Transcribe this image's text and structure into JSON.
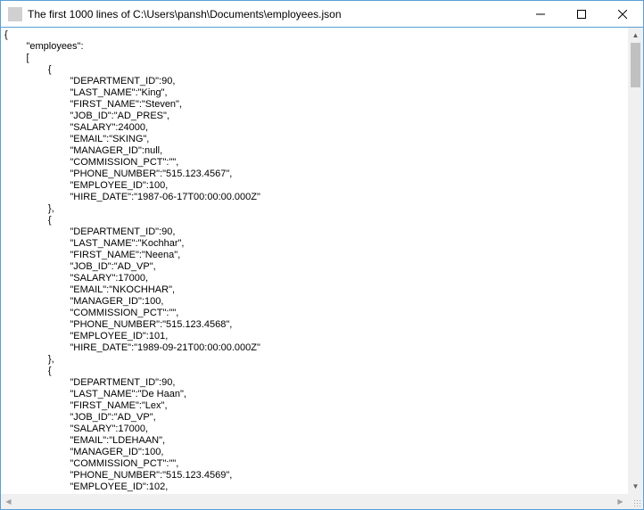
{
  "window": {
    "title": "The first 1000 lines of C:\\Users\\pansh\\Documents\\employees.json"
  },
  "file_text": "{\n\t\"employees\":\n\t[\n\t\t{\n\t\t\t\"DEPARTMENT_ID\":90,\n\t\t\t\"LAST_NAME\":\"King\",\n\t\t\t\"FIRST_NAME\":\"Steven\",\n\t\t\t\"JOB_ID\":\"AD_PRES\",\n\t\t\t\"SALARY\":24000,\n\t\t\t\"EMAIL\":\"SKING\",\n\t\t\t\"MANAGER_ID\":null,\n\t\t\t\"COMMISSION_PCT\":\"\",\n\t\t\t\"PHONE_NUMBER\":\"515.123.4567\",\n\t\t\t\"EMPLOYEE_ID\":100,\n\t\t\t\"HIRE_DATE\":\"1987-06-17T00:00:00.000Z\"\n\t\t},\n\t\t{\n\t\t\t\"DEPARTMENT_ID\":90,\n\t\t\t\"LAST_NAME\":\"Kochhar\",\n\t\t\t\"FIRST_NAME\":\"Neena\",\n\t\t\t\"JOB_ID\":\"AD_VP\",\n\t\t\t\"SALARY\":17000,\n\t\t\t\"EMAIL\":\"NKOCHHAR\",\n\t\t\t\"MANAGER_ID\":100,\n\t\t\t\"COMMISSION_PCT\":\"\",\n\t\t\t\"PHONE_NUMBER\":\"515.123.4568\",\n\t\t\t\"EMPLOYEE_ID\":101,\n\t\t\t\"HIRE_DATE\":\"1989-09-21T00:00:00.000Z\"\n\t\t},\n\t\t{\n\t\t\t\"DEPARTMENT_ID\":90,\n\t\t\t\"LAST_NAME\":\"De Haan\",\n\t\t\t\"FIRST_NAME\":\"Lex\",\n\t\t\t\"JOB_ID\":\"AD_VP\",\n\t\t\t\"SALARY\":17000,\n\t\t\t\"EMAIL\":\"LDEHAAN\",\n\t\t\t\"MANAGER_ID\":100,\n\t\t\t\"COMMISSION_PCT\":\"\",\n\t\t\t\"PHONE_NUMBER\":\"515.123.4569\",\n\t\t\t\"EMPLOYEE_ID\":102,"
}
